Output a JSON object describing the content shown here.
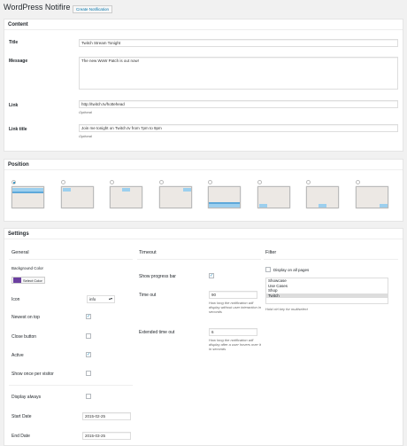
{
  "header": {
    "title": "WordPress Notifire",
    "add_button": "Create Notification"
  },
  "content": {
    "heading": "Content",
    "title_label": "Title",
    "title_value": "Twitch Stream Tonight",
    "message_label": "Message",
    "message_value": "The new WoW Patch is out now!",
    "link_label": "Link",
    "link_value": "http://twitch.tv/hottehead",
    "link_hint": "Optional",
    "linktitle_label": "Link title",
    "linktitle_value": "Join me tonight on Twitch.tv from 7pm to 9pm",
    "linktitle_hint": "Optional"
  },
  "position": {
    "heading": "Position",
    "options": [
      "top-full",
      "top-left",
      "top-center",
      "top-right",
      "bottom-full",
      "bottom-left",
      "bottom-center",
      "bottom-right"
    ],
    "selected_index": 0
  },
  "settings": {
    "heading": "Settings",
    "general": {
      "title": "General",
      "bg_color_label": "Background Color",
      "bg_color_button": "Select Color",
      "bg_color": "#6b3fa0",
      "icon_label": "Icon",
      "icon_value": "info",
      "newest_label": "Newest on top",
      "newest_checked": true,
      "close_label": "Close button",
      "close_checked": false,
      "active_label": "Active",
      "active_checked": true,
      "once_label": "Show once per visitor",
      "once_checked": false,
      "always_label": "Display always",
      "always_checked": false,
      "start_label": "Start Date",
      "start_value": "2015-02-25",
      "end_label": "End Date",
      "end_value": "2015-03-25"
    },
    "timeout": {
      "title": "Timeout",
      "progress_label": "Show progress bar",
      "progress_checked": true,
      "timeout_label": "Time out",
      "timeout_value": "90",
      "timeout_hint": "How long the notification will display without user interaction in seconds",
      "ext_label": "Extended time out",
      "ext_value": "6",
      "ext_hint": "How long the notification will display after a user hovers over it in seconds"
    },
    "filter": {
      "title": "Filter",
      "all_pages_label": "Display on all pages",
      "all_pages_checked": false,
      "pages": [
        "Showcase",
        "Use Cases",
        "Shop",
        "Twitch"
      ],
      "selected_page": "Twitch",
      "hint": "Hold ctrl key for multiselect"
    }
  }
}
